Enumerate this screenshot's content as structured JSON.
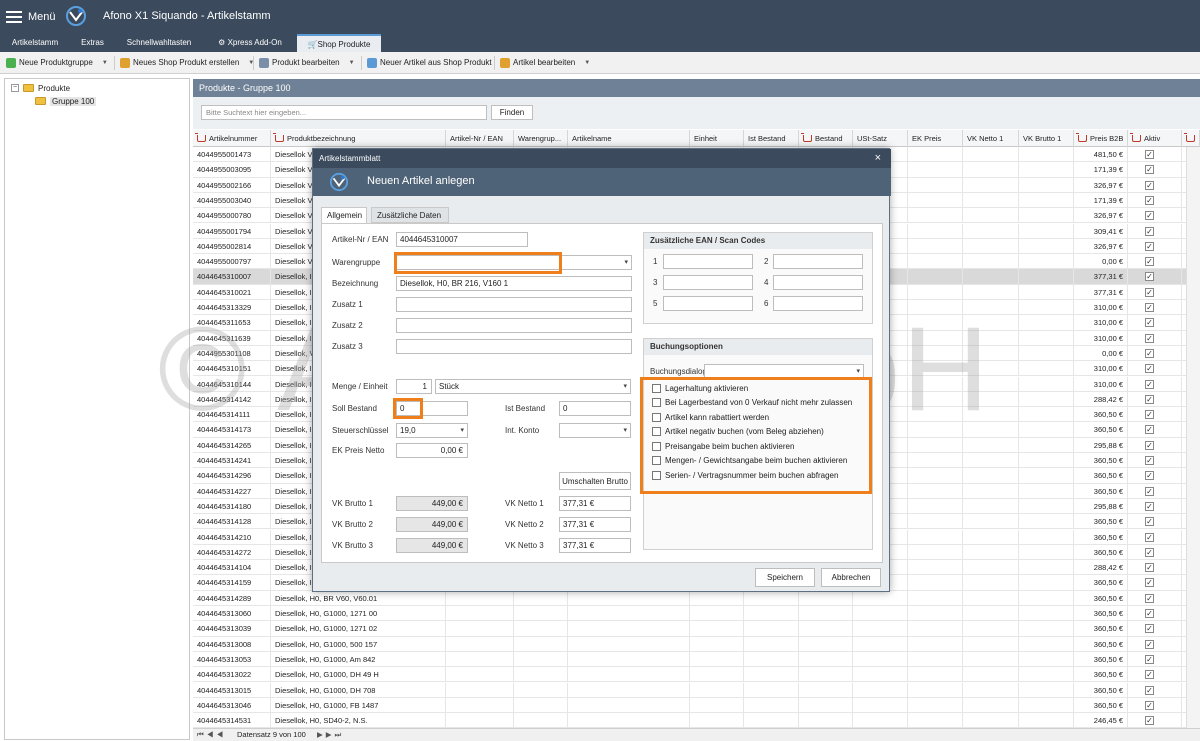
{
  "app": {
    "menu_label": "Menü",
    "title": "Afono X1 Siquando - Artikelstamm"
  },
  "tabs": [
    "Artikelstamm",
    "Extras",
    "Schnellwahltasten",
    "Xpress Add-On",
    "Shop Produkte"
  ],
  "toolbar": {
    "new_group": "Neue Produktgruppe",
    "new_shop_product": "Neues Shop Produkt erstellen",
    "edit_product": "Produkt bearbeiten",
    "new_from_shop": "Neuer Artikel aus Shop Produkt",
    "edit_article": "Artikel bearbeiten"
  },
  "tree": {
    "root": "Produkte",
    "child": "Gruppe 100"
  },
  "panel": {
    "header": "Produkte - Gruppe 100",
    "search_placeholder": "Bitte Suchtext hier eingeben...",
    "find": "Finden"
  },
  "grid": {
    "columns": [
      "Artikelnummer",
      "Produktbezeichnung",
      "Artikel-Nr / EAN",
      "Warengrup...",
      "Artikelname",
      "Einheit",
      "Ist Bestand",
      "Bestand",
      "USt-Satz",
      "EK Preis",
      "VK Netto 1",
      "VK Brutto 1",
      "Preis B2B",
      "Aktiv"
    ],
    "rows": [
      [
        "4044955001473",
        "Diesellok V",
        "481,50 €"
      ],
      [
        "4044955003095",
        "Diesellok V",
        "171,39 €"
      ],
      [
        "4044955002166",
        "Diesellok V",
        "326,97 €"
      ],
      [
        "4044955003040",
        "Diesellok V",
        "171,39 €"
      ],
      [
        "4044955000780",
        "Diesellok V",
        "326,97 €"
      ],
      [
        "4044955001794",
        "Diesellok V",
        "309,41 €"
      ],
      [
        "4044955002814",
        "Diesellok V",
        "326,97 €"
      ],
      [
        "4044955000797",
        "Diesellok V",
        "0,00 €"
      ],
      [
        "4044645310007",
        "Diesellok, I",
        "377,31 €"
      ],
      [
        "4044645310021",
        "Diesellok, I",
        "377,31 €"
      ],
      [
        "4044645313329",
        "Diesellok, I",
        "310,00 €"
      ],
      [
        "4044645311653",
        "Diesellok, I",
        "310,00 €"
      ],
      [
        "4044645311639",
        "Diesellok, I",
        "310,00 €"
      ],
      [
        "4044955301108",
        "Diesellok, V",
        "0,00 €"
      ],
      [
        "4044645310151",
        "Diesellok, I",
        "310,00 €"
      ],
      [
        "4044645310144",
        "Diesellok, I",
        "310,00 €"
      ],
      [
        "4044645314142",
        "Diesellok, I",
        "288,42 €"
      ],
      [
        "4044645314111",
        "Diesellok, I",
        "360,50 €"
      ],
      [
        "4044645314173",
        "Diesellok, I",
        "360,50 €"
      ],
      [
        "4044645314265",
        "Diesellok, I",
        "295,88 €"
      ],
      [
        "4044645314241",
        "Diesellok, I",
        "360,50 €"
      ],
      [
        "4044645314296",
        "Diesellok, I",
        "360,50 €"
      ],
      [
        "4044645314227",
        "Diesellok, I",
        "360,50 €"
      ],
      [
        "4044645314180",
        "Diesellok, I",
        "295,88 €"
      ],
      [
        "4044645314128",
        "Diesellok, I",
        "360,50 €"
      ],
      [
        "4044645314210",
        "Diesellok, I",
        "360,50 €"
      ],
      [
        "4044645314272",
        "Diesellok, I",
        "360,50 €"
      ],
      [
        "4044645314104",
        "Diesellok, I",
        "288,42 €"
      ],
      [
        "4044645314159",
        "Diesellok, I",
        "360,50 €"
      ],
      [
        "4044645314289",
        "Diesellok, H0, BR V60, V60.01",
        "360,50 €"
      ],
      [
        "4044645313060",
        "Diesellok, H0, G1000, 1271 00",
        "360,50 €"
      ],
      [
        "4044645313039",
        "Diesellok, H0, G1000, 1271 02",
        "360,50 €"
      ],
      [
        "4044645313008",
        "Diesellok, H0, G1000, 500 157",
        "360,50 €"
      ],
      [
        "4044645313053",
        "Diesellok, H0, G1000, Am 842",
        "360,50 €"
      ],
      [
        "4044645313022",
        "Diesellok, H0, G1000, DH 49 H",
        "360,50 €"
      ],
      [
        "4044645313015",
        "Diesellok, H0, G1000, DH 708",
        "360,50 €"
      ],
      [
        "4044645313046",
        "Diesellok, H0, G1000, FB 1487",
        "360,50 €"
      ],
      [
        "4044645314531",
        "Diesellok, H0, SD40-2,  N.S.",
        "246,45 €"
      ]
    ],
    "navigator": "Datensatz 9 von 100"
  },
  "dialog": {
    "window_title": "Artikelstammblatt",
    "heading": "Neuen Artikel anlegen",
    "tabs": [
      "Allgemein",
      "Zusätzliche Daten"
    ],
    "labels": {
      "ean": "Artikel-Nr / EAN",
      "group": "Warengruppe",
      "desc": "Bezeichnung",
      "z1": "Zusatz 1",
      "z2": "Zusatz 2",
      "z3": "Zusatz 3",
      "qty": "Menge / Einheit",
      "soll": "Soll Bestand",
      "tax": "Steuerschlüssel",
      "ek": "EK Preis Netto",
      "ist": "Ist Bestand",
      "konto": "Int. Konto",
      "vkb1": "VK Brutto 1",
      "vkb2": "VK Brutto 2",
      "vkb3": "VK Brutto 3",
      "vkn1": "VK Netto 1",
      "vkn2": "VK Netto 2",
      "vkn3": "VK Netto 3"
    },
    "values": {
      "ean": "4044645310007",
      "group": "",
      "desc": "Diesellok, H0, BR 216, V160 1",
      "qty": "1",
      "unit": "Stück",
      "soll": "0",
      "tax": "19,0",
      "ek": "0,00 €",
      "ist": "0",
      "vkb1": "449,00 €",
      "vkb2": "449,00 €",
      "vkb3": "449,00 €",
      "vkn1": "377,31 €",
      "vkn2": "377,31 €",
      "vkn3": "377,31 €"
    },
    "toggle_brutto": "Umschalten Brutto",
    "ean_group": {
      "title": "Zusätzliche EAN / Scan Codes",
      "nums": [
        "1",
        "2",
        "3",
        "4",
        "5",
        "6"
      ]
    },
    "options_group": {
      "title": "Buchungsoptionen",
      "dialog_label": "Buchungsdialog",
      "checks": [
        "Lagerhaltung aktivieren",
        "Bei Lagerbestand von 0 Verkauf nicht mehr zulassen",
        "Artikel kann rabattiert werden",
        "Artikel negativ buchen (vom Beleg abziehen)",
        "Preisangabe beim buchen aktivieren",
        "Mengen- / Gewichtsangabe beim buchen aktivieren",
        "Serien- / Vertragsnummer beim buchen abfragen"
      ]
    },
    "save": "Speichern",
    "cancel": "Abbrechen",
    "close": "×"
  },
  "watermark": "© Afono GmbH",
  "colors": {
    "titlebar": "#3b4a5c",
    "highlight": "#ef7f1a",
    "panel_header": "#6f8196"
  }
}
